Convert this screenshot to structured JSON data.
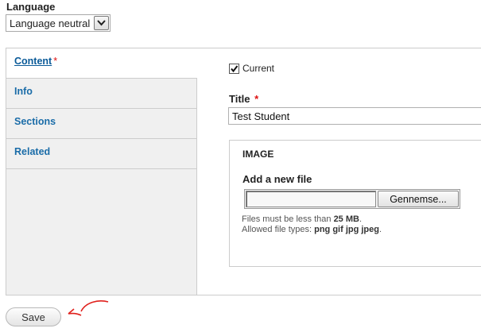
{
  "language": {
    "label": "Language",
    "selected": "Language neutral"
  },
  "vertical_tabs": [
    {
      "label": "Content",
      "required_marker": "*",
      "active": true
    },
    {
      "label": "Info"
    },
    {
      "label": "Sections"
    },
    {
      "label": "Related"
    }
  ],
  "content": {
    "current_label": "Current",
    "current_checked": true,
    "title_label": "Title",
    "title_required": "*",
    "title_value": "Test Student",
    "image": {
      "legend": "IMAGE",
      "add_file_label": "Add a new file",
      "browse_label": "Gennemse...",
      "help_prefix": "Files must be less than ",
      "help_size": "25 MB",
      "help_suffix": ".",
      "help_types_prefix": "Allowed file types: ",
      "help_types": "png gif jpg jpeg",
      "help_types_suffix": "."
    }
  },
  "save_label": "Save",
  "colors": {
    "tab_link": "#1a6ca8",
    "required": "#dd1111",
    "annotation_arrow": "#e0201c"
  }
}
